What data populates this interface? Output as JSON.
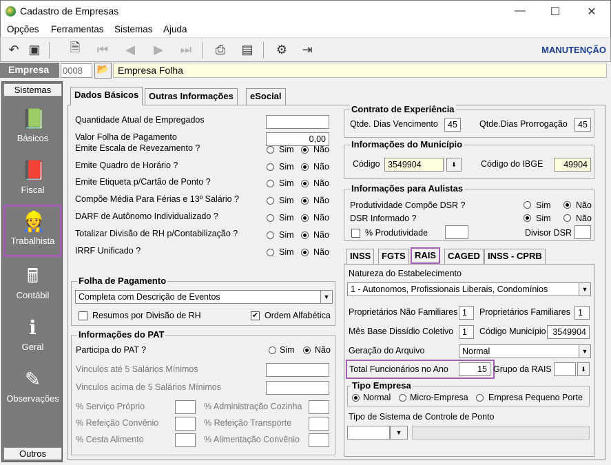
{
  "window": {
    "title": "Cadastro de Empresas",
    "minimize": "—",
    "maximize": "☐",
    "close": "✕"
  },
  "menu": [
    "Opções",
    "Ferramentas",
    "Sistemas",
    "Ajuda"
  ],
  "toolbar": {
    "mode": "MANUTENÇÃO",
    "icons": [
      "undo-icon",
      "save-icon",
      "preview-icon",
      "first-icon",
      "prev-icon",
      "next-icon",
      "last-icon",
      "print-icon",
      "report-icon",
      "tools-icon",
      "exit-icon"
    ]
  },
  "empresa": {
    "label": "Empresa",
    "code": "0008",
    "name": "Empresa Folha"
  },
  "sidebar": {
    "header": "Sistemas",
    "footer": "Outros",
    "items": [
      {
        "label": "Básicos",
        "icon": "book-icon"
      },
      {
        "label": "Fiscal",
        "icon": "fiscal-icon"
      },
      {
        "label": "Trabalhista",
        "icon": "worker-icon"
      },
      {
        "label": "Contábil",
        "icon": "calculator-icon"
      },
      {
        "label": "Geral",
        "icon": "info-icon"
      },
      {
        "label": "Observações",
        "icon": "pen-icon"
      }
    ]
  },
  "tabs": [
    "Dados Básicos",
    "Outras Informações",
    "eSocial"
  ],
  "dados": {
    "qtd_label": "Quantidade Atual de Empregados",
    "qtd_value": "",
    "valor_label": "Valor Folha de Pagamento",
    "valor_value": "0,00",
    "sim": "Sim",
    "nao": "Não",
    "questions": [
      "Emite Escala de Revezamento ?",
      "Emite Quadro de Horário ?",
      "Emite Etiqueta p/Cartão de Ponto ?",
      "Compõe Média Para Férias e 13º Salário ?",
      "DARF de Autônomo Individualizado ?",
      "Totalizar Divisão de RH p/Contabilização ?",
      "IRRF Unificado ?"
    ]
  },
  "folha": {
    "title": "Folha de Pagamento",
    "value": "Completa com Descrição de Eventos",
    "resumos": "Resumos por Divisão de RH",
    "ordem": "Ordem Alfabética"
  },
  "pat": {
    "title": "Informações do PAT",
    "participa": "Participa do PAT ?",
    "v5": "Vinculos até 5 Salários Mínimos",
    "vacima": "Vinculos acima de 5 Salários Mínimos",
    "serv": "% Serviço Próprio",
    "adm": "% Administração Cozinha",
    "refc": "% Refeição Convênio",
    "reft": "% Refeição Transporte",
    "cesta": "% Cesta Alimento",
    "alim": "% Alimentação Convênio"
  },
  "contrato": {
    "title": "Contrato de Experiência",
    "venc_label": "Qtde. Dias Vencimento",
    "venc": "45",
    "prorr_label": "Qtde.Dias Prorrogação",
    "prorr": "45"
  },
  "municipio": {
    "title": "Informações do Município",
    "codigo_label": "Código",
    "codigo": "3549904",
    "ibge_label": "Código do IBGE",
    "ibge": "49904"
  },
  "aulistas": {
    "title": "Informações para Aulistas",
    "prod_label": "Produtividade Compõe DSR ?",
    "dsr_label": "DSR Informado ?",
    "pct_label": "% Produtividade",
    "divisor_label": "Divisor DSR"
  },
  "subtabs": [
    "INSS",
    "FGTS",
    "RAIS",
    "CAGED",
    "INSS - CPRB"
  ],
  "rais": {
    "natureza_label": "Natureza do Estabelecimento",
    "natureza": "1 - Autonomos, Profissionais Liberais, Condomínios",
    "pnf_label": "Proprietários Não Familiares",
    "pnf": "1",
    "pf_label": "Proprietários Familiares",
    "pf": "1",
    "mes_label": "Mês Base Dissídio Coletivo",
    "mes": "1",
    "codmun_label": "Código Município",
    "codmun": "3549904",
    "geracao_label": "Geração do  Arquivo",
    "geracao": "Normal",
    "total_label": "Total Funcionários no Ano",
    "total": "15",
    "grupo_label": "Grupo da RAIS",
    "tipo_title": "Tipo Empresa",
    "tipos": [
      "Normal",
      "Micro-Empresa",
      "Empresa Pequeno Porte"
    ],
    "ponto_label": "Tipo de Sistema de Controle de Ponto"
  }
}
